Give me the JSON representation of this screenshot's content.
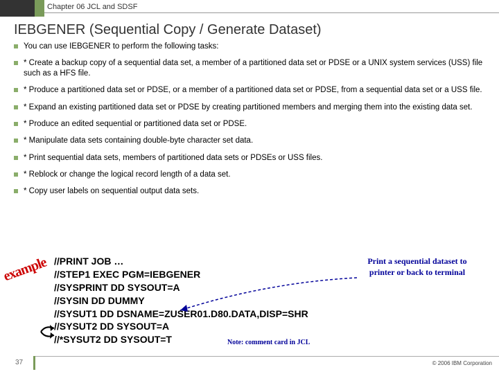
{
  "header": {
    "chapter": "Chapter 06 JCL and SDSF"
  },
  "title": "IEBGENER (Sequential Copy / Generate Dataset)",
  "bullets": [
    "You can use IEBGENER to perform the following tasks:",
    "* Create a backup copy of a sequential data set, a member of a partitioned data set or PDSE or a UNIX system services (USS) file such as a HFS file.",
    "* Produce a partitioned data set or PDSE, or a member of a partitioned data set or PDSE, from a sequential data set or a USS file.",
    "* Expand an existing partitioned data set or PDSE by creating partitioned members and merging them into the existing data set.",
    "* Produce an edited sequential or partitioned data set or PDSE.",
    "* Manipulate data sets containing double-byte character set data.",
    "* Print sequential data sets, members of partitioned data sets or PDSEs or USS files.",
    "* Reblock or change the logical record length of a data set.",
    "* Copy user labels on sequential output data sets."
  ],
  "code": "//PRINT JOB …\n//STEP1 EXEC PGM=IEBGENER\n//SYSPRINT DD SYSOUT=A\n//SYSIN DD DUMMY\n//SYSUT1 DD DSNAME=ZUSER01.D80.DATA,DISP=SHR\n//SYSUT2 DD SYSOUT=A\n//*SYSUT2 DD SYSOUT=T",
  "example_label": "example",
  "annotation_right": "Print a sequential dataset to printer or back to terminal",
  "annotation_note": "Note: comment card in JCL",
  "footer": {
    "slide": "37",
    "copyright": "© 2006 IBM Corporation"
  }
}
